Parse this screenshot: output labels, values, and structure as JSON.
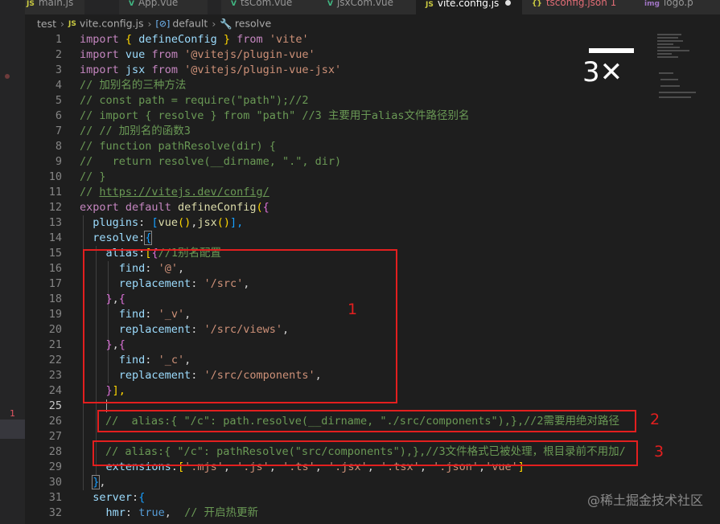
{
  "tabs": [
    {
      "label": "main.js",
      "icon": "JS"
    },
    {
      "label": "App.vue",
      "icon": "V"
    },
    {
      "label": "tsCom.vue",
      "icon": "V"
    },
    {
      "label": "jsxCom.vue",
      "icon": "V"
    },
    {
      "label": "vite.config.js",
      "icon": "JS"
    },
    {
      "label": "tsconfig.json 1",
      "icon": "{}"
    },
    {
      "label": "logo.p",
      "icon": "img"
    }
  ],
  "breadcrumb": {
    "folder": "test",
    "file": "vite.config.js",
    "symbol1": "default",
    "symbol2": "resolve",
    "file_icon": "JS"
  },
  "gutter_marker": "1",
  "annotations": {
    "label1": "1",
    "label2": "2",
    "label3": "3"
  },
  "overlay_badge": "3✕",
  "watermark": "@稀土掘金技术社区",
  "line_numbers": [
    "1",
    "2",
    "3",
    "4",
    "5",
    "6",
    "7",
    "8",
    "9",
    "10",
    "11",
    "12",
    "13",
    "14",
    "15",
    "16",
    "17",
    "18",
    "19",
    "20",
    "21",
    "22",
    "23",
    "24",
    "25",
    "26",
    "27",
    "28",
    "29",
    "30",
    "31",
    "32"
  ],
  "code": {
    "l1": [
      "import",
      "{",
      "defineConfig",
      "}",
      "from",
      "'vite'"
    ],
    "l2": [
      "import",
      "vue",
      "from",
      "'@vitejs/plugin-vue'"
    ],
    "l3": [
      "import",
      "jsx",
      "from",
      "'@vitejs/plugin-vue-jsx'"
    ],
    "l4": "// 加别名的三种方法",
    "l5": "// const path = require(\"path\");//2",
    "l6": "// import { resolve } from \"path\" //3 主要用于alias文件路径别名",
    "l7": "// // 加别名的函数3",
    "l8": "// function pathResolve(dir) {",
    "l9": "//   return resolve(__dirname, \".\", dir)",
    "l10": "// }",
    "l11": [
      "// ",
      "https://vitejs.dev/config/"
    ],
    "l12": [
      "export",
      "default",
      "defineConfig",
      "(",
      "{"
    ],
    "l13": [
      "plugins",
      ":",
      "[",
      "vue",
      "()",
      ",",
      "jsx",
      "()",
      "],"
    ],
    "l14": [
      "resolve",
      ":",
      "{"
    ],
    "l15": [
      "alias",
      ":",
      "[",
      "{",
      "//1别名配置"
    ],
    "l16": [
      "find",
      ":",
      "'@'",
      ","
    ],
    "l17": [
      "replacement",
      ":",
      "'/src'",
      ","
    ],
    "l18": [
      "}",
      ",",
      "{"
    ],
    "l19": [
      "find",
      ":",
      "'_v'",
      ","
    ],
    "l20": [
      "replacement",
      ":",
      "'/src/views'",
      ","
    ],
    "l21": [
      "}",
      ",",
      "{"
    ],
    "l22": [
      "find",
      ":",
      "'_c'",
      ","
    ],
    "l23": [
      "replacement",
      ":",
      "'/src/components'",
      ","
    ],
    "l24": [
      "}",
      "],"
    ],
    "l26": "//  alias:{ \"/c\": path.resolve(__dirname, \"./src/components\"),},//2需要用绝对路径",
    "l28": "// alias:{ \"/c\": pathResolve(\"src/components\"),},//3文件格式已被处理，根目录前不用加/",
    "l29": [
      "extensions",
      ":",
      "[",
      "'.mjs'",
      ",",
      "'.js'",
      ",",
      "'.ts'",
      ",",
      "'.jsx'",
      ",",
      "'.tsx'",
      ",",
      "'.json'",
      ",",
      "'vue'",
      "]"
    ],
    "l30": [
      "}",
      ","
    ],
    "l31": [
      "server",
      ":",
      "{"
    ],
    "l32": [
      "hmr",
      ":",
      "true",
      ",",
      "// 开启热更新"
    ]
  }
}
